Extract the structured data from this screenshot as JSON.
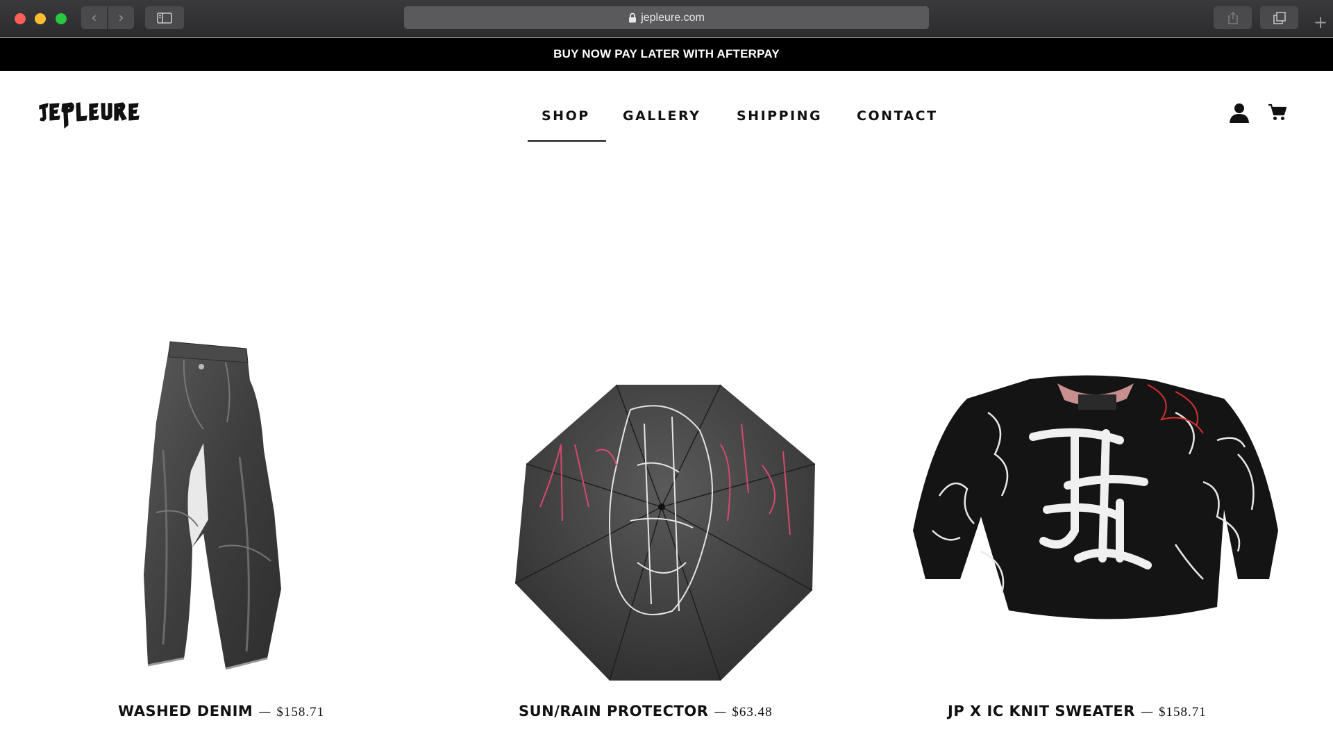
{
  "browser": {
    "url": "jepleure.com",
    "icons": {
      "back": "chevron-left-icon",
      "forward": "chevron-right-icon",
      "sidebar": "sidebar-icon",
      "lock": "lock-icon",
      "share": "share-icon",
      "tabs": "tabs-icon",
      "new_tab": "plus-icon"
    },
    "back_glyph": "‹",
    "forward_glyph": "›",
    "new_tab_glyph": "+"
  },
  "announcement": {
    "text": "BUY NOW PAY LATER WITH AFTERPAY"
  },
  "header": {
    "logo_text": "JEPLEURE",
    "nav": [
      {
        "label": "SHOP",
        "active": true
      },
      {
        "label": "GALLERY",
        "active": false
      },
      {
        "label": "SHIPPING",
        "active": false
      },
      {
        "label": "CONTACT",
        "active": false
      }
    ],
    "account_icon": "account-icon",
    "cart_icon": "cart-icon"
  },
  "products": [
    {
      "title": "WASHED DENIM",
      "separator": "—",
      "price": "$158.71",
      "image": "washed-denim-image"
    },
    {
      "title": "SUN/RAIN PROTECTOR",
      "separator": "—",
      "price": "$63.48",
      "image": "umbrella-image"
    },
    {
      "title": "JP X IC KNIT SWEATER",
      "separator": "—",
      "price": "$158.71",
      "image": "knit-sweater-image"
    }
  ],
  "colors": {
    "announcement_bg": "#000000",
    "text": "#111111",
    "page_bg": "#ffffff",
    "chrome_bg": "#2c2c2e"
  }
}
